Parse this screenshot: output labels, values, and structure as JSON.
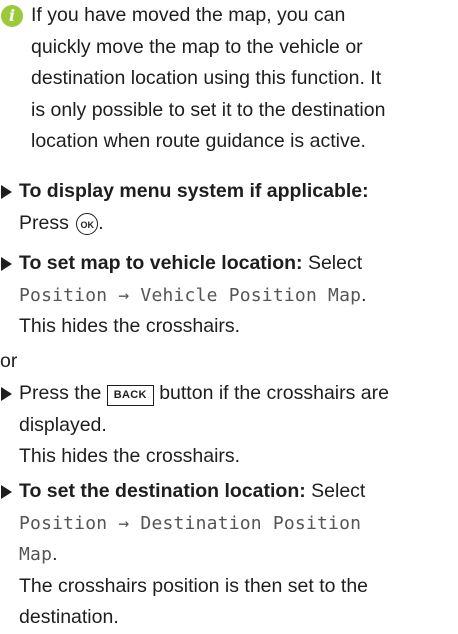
{
  "note": {
    "icon": "info-icon",
    "icon_glyph": "i",
    "icon_color": "#9aca3c",
    "lines": [
      "If you have moved the map, you can",
      "quickly move the map to the vehicle or",
      "destination location using this function. It",
      "is only possible to set it to the destination",
      "location when route guidance is active."
    ]
  },
  "steps": [
    {
      "heading": "To display menu system if applicable:",
      "press_label": "Press",
      "key": "OK",
      "period": "."
    },
    {
      "heading": "To set map to vehicle location:",
      "select_label": "Select",
      "menu_path": "Position → Vehicle Position Map",
      "period": ".",
      "result": "This hides the crosshairs."
    },
    {
      "press_the": "Press the",
      "key": "BACK",
      "text_after_key": "button if the crosshairs are",
      "line2": "displayed.",
      "result": "This hides the crosshairs."
    },
    {
      "heading": "To set the destination location:",
      "select_label": "Select",
      "menu_path_line1": "Position → Destination Position",
      "menu_path_line2": "Map",
      "period": ".",
      "result_line1": "The crosshairs position is then set to the",
      "result_line2": "destination."
    }
  ],
  "or_text": "or"
}
